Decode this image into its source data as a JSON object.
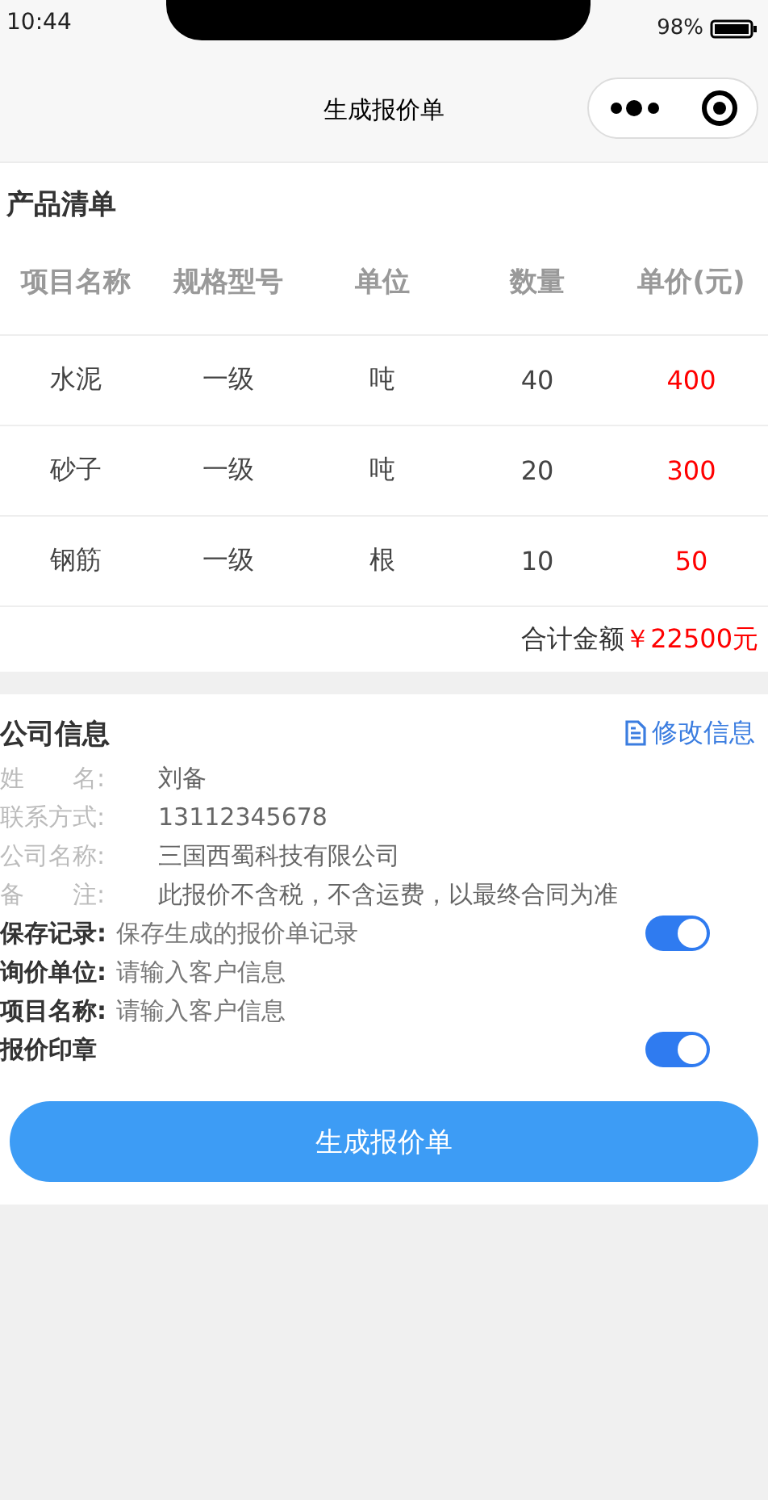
{
  "status_bar": {
    "time": "10:44",
    "battery_text": "98%"
  },
  "nav": {
    "title": "生成报价单"
  },
  "products": {
    "title": "产品清单",
    "columns": [
      "项目名称",
      "规格型号",
      "单位",
      "数量",
      "单价(元)"
    ],
    "rows": [
      [
        "水泥",
        "一级",
        "吨",
        "40",
        "400"
      ],
      [
        "砂子",
        "一级",
        "吨",
        "20",
        "300"
      ],
      [
        "钢筋",
        "一级",
        "根",
        "10",
        "50"
      ]
    ],
    "total_label": "合计金额",
    "total_value": "￥22500元"
  },
  "company": {
    "title": "公司信息",
    "edit_link": "修改信息",
    "info": [
      {
        "label": "姓　　名:",
        "value": "刘备"
      },
      {
        "label": "联系方式:",
        "value": "13112345678"
      },
      {
        "label": "公司名称:",
        "value": "三国西蜀科技有限公司"
      },
      {
        "label": "备　　注:",
        "value": "此报价不含税，不含运费，以最终合同为准"
      }
    ],
    "options": [
      {
        "kind": "toggle",
        "label": "保存记录:",
        "text": "保存生成的报价单记录",
        "on": true
      },
      {
        "kind": "input",
        "label": "询价单位:",
        "placeholder": "请输入客户信息"
      },
      {
        "kind": "input",
        "label": "项目名称:",
        "placeholder": "请输入客户信息"
      },
      {
        "kind": "toggle",
        "label": "报价印章",
        "on": true
      }
    ]
  },
  "submit_button": "生成报价单"
}
